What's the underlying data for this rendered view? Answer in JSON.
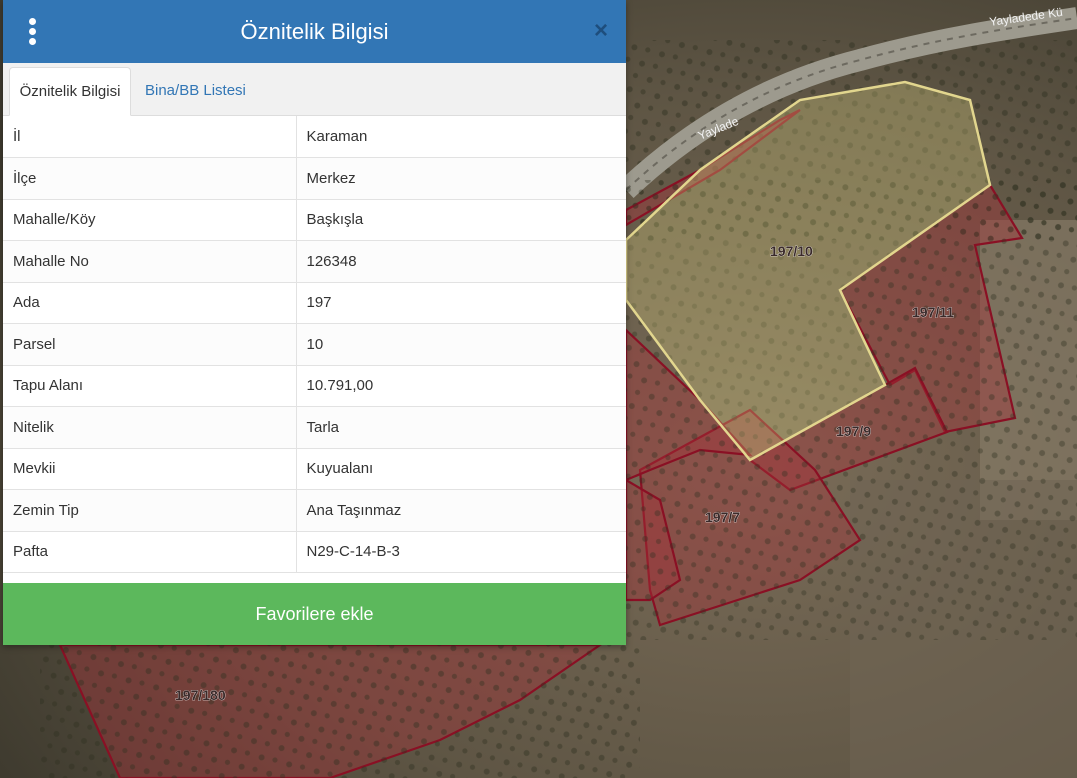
{
  "panel": {
    "title": "Öznitelik Bilgisi",
    "menu_icon": "vertical-dots-icon",
    "close_icon": "close-icon",
    "header_color": "#3276b5"
  },
  "tabs": [
    {
      "label": "Öznitelik Bilgisi",
      "active": true
    },
    {
      "label": "Bina/BB Listesi",
      "active": false
    }
  ],
  "attributes": [
    {
      "key": "İl",
      "value": "Karaman"
    },
    {
      "key": "İlçe",
      "value": "Merkez"
    },
    {
      "key": "Mahalle/Köy",
      "value": "Başkışla"
    },
    {
      "key": "Mahalle No",
      "value": "126348"
    },
    {
      "key": "Ada",
      "value": "197"
    },
    {
      "key": "Parsel",
      "value": "10"
    },
    {
      "key": "Tapu Alanı",
      "value": "10.791,00"
    },
    {
      "key": "Nitelik",
      "value": "Tarla"
    },
    {
      "key": "Mevkii",
      "value": "Kuyualanı"
    },
    {
      "key": "Zemin Tip",
      "value": "Ana Taşınmaz"
    },
    {
      "key": "Pafta",
      "value": "N29-C-14-B-3"
    }
  ],
  "favorite_button": {
    "label": "Favorilere ekle",
    "color": "#5cb85c"
  },
  "map": {
    "road_label_1": "Yaylade",
    "road_label_2": "Yayladede Kü",
    "parcels": {
      "p10": "197/10",
      "p11": "197/11",
      "p9": "197/9",
      "p7": "197/7",
      "p180": "197/180"
    },
    "selected_parcel_color": "#d8cc80",
    "parcel_border_color": "#8a1024"
  }
}
